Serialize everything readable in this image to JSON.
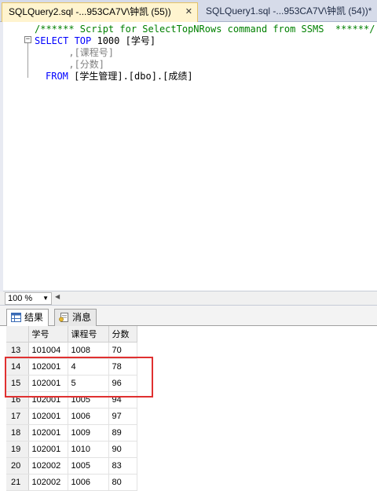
{
  "tabs": [
    {
      "label": "SQLQuery2.sql -...953CA7V\\钟凯 (55))",
      "close": "✕"
    },
    {
      "label": "SQLQuery1.sql -...953CA7V\\钟凯 (54))*"
    }
  ],
  "editor": {
    "comment": "/****** Script for SelectTopNRows command from SSMS  ******/",
    "line_select_kw": "SELECT TOP",
    "line_select_rest": " 1000 [学号]",
    "line2": "      ,[课程号]",
    "line3": "      ,[分数]",
    "from_kw": "FROM",
    "from_rest": " [学生管理].[dbo].[成绩]"
  },
  "zoom": {
    "value": "100 %"
  },
  "result_tabs": [
    {
      "label": "结果",
      "icon": "grid-results-icon"
    },
    {
      "label": "消息",
      "icon": "messages-icon"
    }
  ],
  "grid": {
    "columns": [
      "学号",
      "课程号",
      "分数"
    ],
    "rows": [
      {
        "n": "13",
        "v": [
          "101004",
          "1008",
          "70"
        ]
      },
      {
        "n": "14",
        "v": [
          "102001",
          "4",
          "78"
        ]
      },
      {
        "n": "15",
        "v": [
          "102001",
          "5",
          "96"
        ]
      },
      {
        "n": "16",
        "v": [
          "102001",
          "1005",
          "94"
        ]
      },
      {
        "n": "17",
        "v": [
          "102001",
          "1006",
          "97"
        ]
      },
      {
        "n": "18",
        "v": [
          "102001",
          "1009",
          "89"
        ]
      },
      {
        "n": "19",
        "v": [
          "102001",
          "1010",
          "90"
        ]
      },
      {
        "n": "20",
        "v": [
          "102002",
          "1005",
          "83"
        ]
      },
      {
        "n": "21",
        "v": [
          "102002",
          "1006",
          "80"
        ]
      }
    ]
  },
  "colors": {
    "highlight": "#e03030",
    "keyword": "#0000ff",
    "comment": "#008000",
    "active_tab": "#fff4cf"
  }
}
